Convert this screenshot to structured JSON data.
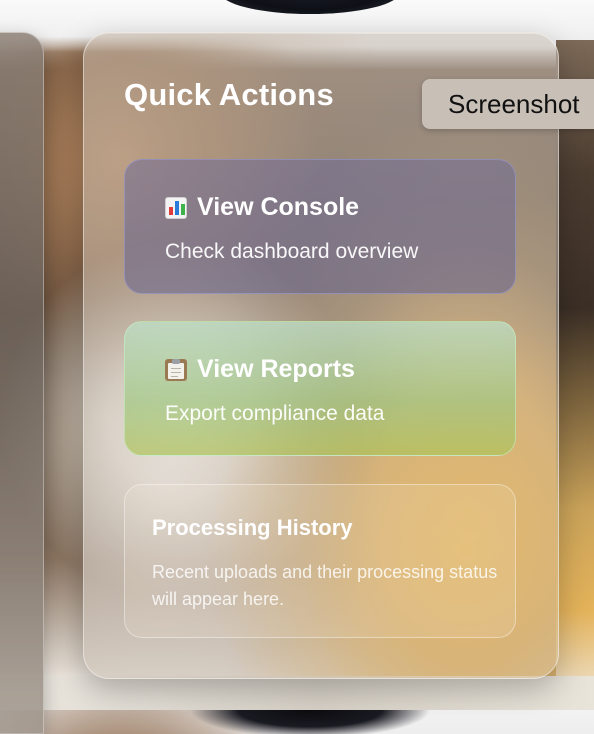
{
  "panel": {
    "title": "Quick Actions"
  },
  "actions": [
    {
      "icon": "bar-chart-icon",
      "title": "View Console",
      "subtitle": "Check dashboard overview",
      "accent": "#6f6c96"
    },
    {
      "icon": "clipboard-icon",
      "title": "View Reports",
      "subtitle": "Export compliance data",
      "accent": "#b7d6a0"
    }
  ],
  "history": {
    "title": "Processing History",
    "description": "Recent uploads and their processing status will appear here."
  },
  "overlay": {
    "label": "Screenshot"
  }
}
